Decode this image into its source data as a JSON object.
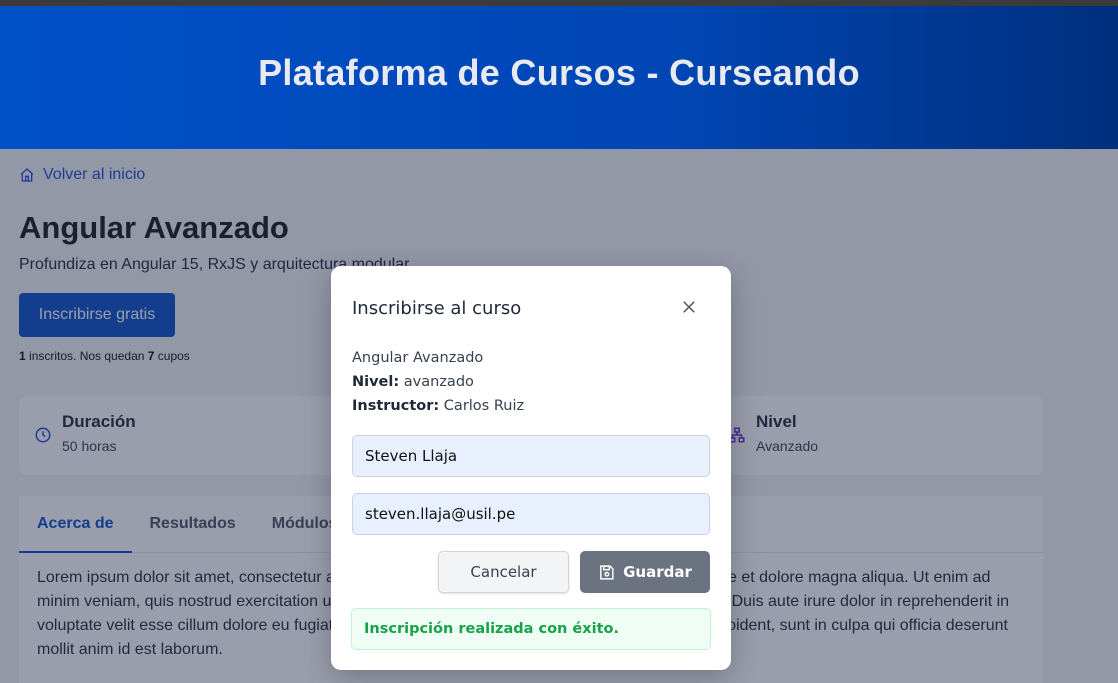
{
  "header": {
    "title": "Plataforma de Cursos - Curseando"
  },
  "nav": {
    "back_label": "Volver al inicio"
  },
  "course": {
    "title": "Angular Avanzado",
    "description": "Profundiza en Angular 15, RxJS y arquitectura modular",
    "enroll_label": "Inscribirse gratis",
    "enrolled_count": "1",
    "enrolled_text_1": " inscritos. Nos quedan ",
    "seats_left": "7",
    "enrolled_text_2": " cupos"
  },
  "stats": {
    "duration_label": "Duración",
    "duration_value": "50 horas",
    "level_label": "Nivel",
    "level_value": "Avanzado"
  },
  "tabs": {
    "about": "Acerca de",
    "results": "Resultados",
    "modules": "Módulos"
  },
  "about_text": "Lorem ipsum dolor sit amet, consectetur adipiscing elit, sed do eiusmod tempor incididunt ut labore et dolore magna aliqua. Ut enim ad minim veniam, quis nostrud exercitation ullamco laboris nisi ut aliquip ex ea commodo consequat. Duis aute irure dolor in reprehenderit in voluptate velit esse cillum dolore eu fugiat nulla pariatur. Excepteur sint occaecat cupidatat non proident, sunt in culpa qui officia deserunt mollit anim id est laborum.",
  "modal": {
    "title": "Inscribirse al curso",
    "course_name": "Angular Avanzado",
    "level_label": "Nivel:",
    "level_value": " avanzado",
    "instructor_label": "Instructor:",
    "instructor_value": " Carlos Ruiz",
    "name_value": "Steven Llaja",
    "email_value": "steven.llaja@usil.pe",
    "cancel_label": "Cancelar",
    "save_label": "Guardar",
    "success_message": "Inscripción realizada con éxito."
  },
  "colors": {
    "primary": "#0a4fc6",
    "success": "#16a34a",
    "save_button": "#6b7280"
  }
}
